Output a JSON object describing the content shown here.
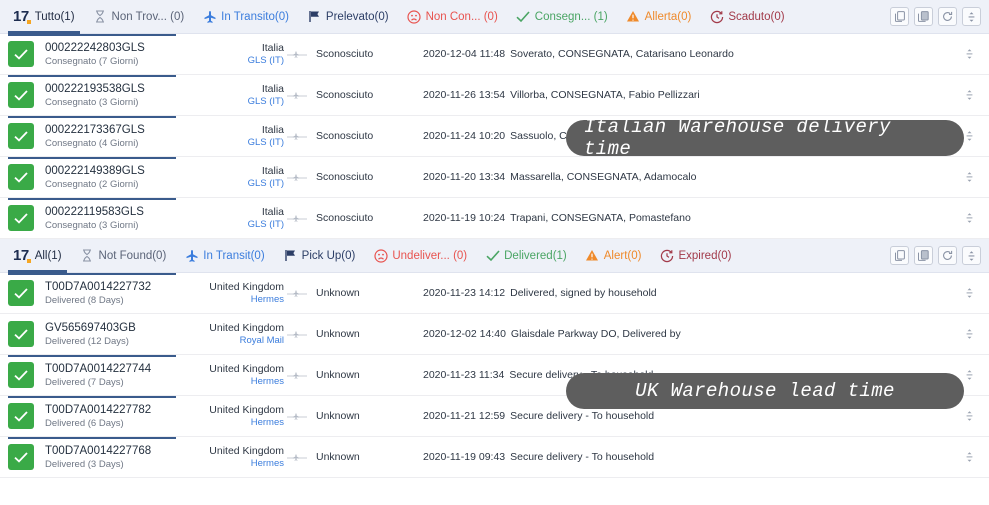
{
  "brand": {
    "logo_text": "17"
  },
  "panels": [
    {
      "id": "italian",
      "tabs": [
        {
          "label": "Tutto(1)",
          "icon": "logo-17-icon",
          "tone": "active"
        },
        {
          "label": "Non Trov... (0)",
          "icon": "hourglass-icon",
          "tone": "grey"
        },
        {
          "label": "In Transito(0)",
          "icon": "airplane-icon",
          "tone": "blue"
        },
        {
          "label": "Prelevato(0)",
          "icon": "flag-icon",
          "tone": "navy"
        },
        {
          "label": "Non Con... (0)",
          "icon": "sad-face-icon",
          "tone": "red"
        },
        {
          "label": "Consegn... (1)",
          "icon": "check-icon",
          "tone": "green"
        },
        {
          "label": "Allerta(0)",
          "icon": "warning-icon",
          "tone": "orange"
        },
        {
          "label": "Scaduto(0)",
          "icon": "clock-expired-icon",
          "tone": "maroon"
        }
      ],
      "toolbar": [
        {
          "name": "copy-button",
          "icon": "copy-icon"
        },
        {
          "name": "copy-all-button",
          "icon": "copy-multiple-icon"
        },
        {
          "name": "refresh-button",
          "icon": "refresh-icon"
        },
        {
          "name": "more-options-button",
          "icon": "more-vertical-icon"
        }
      ],
      "rows": [
        {
          "status": "delivered",
          "number": "000222242803GLS",
          "sub": "Consegnato (7 Giorni)",
          "country": "Italia",
          "carrier": "GLS (IT)",
          "destination": "Sconosciuto",
          "event_time": "2020-12-04 11:48",
          "event_text": "Soverato, CONSEGNATA, Catarisano Leonardo"
        },
        {
          "status": "delivered",
          "number": "000222193538GLS",
          "sub": "Consegnato (3 Giorni)",
          "country": "Italia",
          "carrier": "GLS (IT)",
          "destination": "Sconosciuto",
          "event_time": "2020-11-26 13:54",
          "event_text": "Villorba, CONSEGNATA, Fabio Pellizzari"
        },
        {
          "status": "delivered",
          "number": "000222173367GLS",
          "sub": "Consegnato (4 Giorni)",
          "country": "Italia",
          "carrier": "GLS (IT)",
          "destination": "Sconosciuto",
          "event_time": "2020-11-24 10:20",
          "event_text": "Sassuolo, CONSEGNATA, Cinzia Pieroni"
        },
        {
          "status": "delivered",
          "number": "000222149389GLS",
          "sub": "Consegnato (2 Giorni)",
          "country": "Italia",
          "carrier": "GLS (IT)",
          "destination": "Sconosciuto",
          "event_time": "2020-11-20 13:34",
          "event_text": "Massarella, CONSEGNATA, Adamocalo"
        },
        {
          "status": "delivered",
          "number": "000222119583GLS",
          "sub": "Consegnato (3 Giorni)",
          "country": "Italia",
          "carrier": "GLS (IT)",
          "destination": "Sconosciuto",
          "event_time": "2020-11-19 10:24",
          "event_text": "Trapani, CONSEGNATA, Pomastefano"
        }
      ],
      "annotation": "Italian Warehouse delivery time"
    },
    {
      "id": "uk",
      "tabs": [
        {
          "label": "All(1)",
          "icon": "logo-17-icon",
          "tone": "active"
        },
        {
          "label": "Not Found(0)",
          "icon": "hourglass-icon",
          "tone": "grey"
        },
        {
          "label": "In Transit(0)",
          "icon": "airplane-icon",
          "tone": "blue"
        },
        {
          "label": "Pick Up(0)",
          "icon": "flag-icon",
          "tone": "navy"
        },
        {
          "label": "Undeliver... (0)",
          "icon": "sad-face-icon",
          "tone": "red"
        },
        {
          "label": "Delivered(1)",
          "icon": "check-icon",
          "tone": "green"
        },
        {
          "label": "Alert(0)",
          "icon": "warning-icon",
          "tone": "orange"
        },
        {
          "label": "Expired(0)",
          "icon": "clock-expired-icon",
          "tone": "maroon"
        }
      ],
      "toolbar": [
        {
          "name": "copy-button",
          "icon": "copy-icon"
        },
        {
          "name": "copy-all-button",
          "icon": "copy-multiple-icon"
        },
        {
          "name": "refresh-button",
          "icon": "refresh-icon"
        },
        {
          "name": "more-options-button",
          "icon": "more-vertical-icon"
        }
      ],
      "rows": [
        {
          "status": "delivered",
          "number": "T00D7A0014227732",
          "sub": "Delivered (8 Days)",
          "country": "United Kingdom",
          "carrier": "Hermes",
          "destination": "Unknown",
          "event_time": "2020-11-23 14:12",
          "event_text": "Delivered, signed by household"
        },
        {
          "status": "delivered",
          "number": "GV565697403GB",
          "sub": "Delivered (12 Days)",
          "country": "United Kingdom",
          "carrier": "Royal Mail",
          "destination": "Unknown",
          "event_time": "2020-12-02 14:40",
          "event_text": "Glaisdale Parkway DO, Delivered by"
        },
        {
          "status": "delivered",
          "number": "T00D7A0014227744",
          "sub": "Delivered (7 Days)",
          "country": "United Kingdom",
          "carrier": "Hermes",
          "destination": "Unknown",
          "event_time": "2020-11-23 11:34",
          "event_text": "Secure delivery - To household"
        },
        {
          "status": "delivered",
          "number": "T00D7A0014227782",
          "sub": "Delivered (6 Days)",
          "country": "United Kingdom",
          "carrier": "Hermes",
          "destination": "Unknown",
          "event_time": "2020-11-21 12:59",
          "event_text": "Secure delivery - To household"
        },
        {
          "status": "delivered",
          "number": "T00D7A0014227768",
          "sub": "Delivered (3 Days)",
          "country": "United Kingdom",
          "carrier": "Hermes",
          "destination": "Unknown",
          "event_time": "2020-11-19 09:43",
          "event_text": "Secure delivery - To household"
        }
      ],
      "annotation": "UK Warehouse lead time"
    }
  ],
  "colors": {
    "tabbar_bg": "#eef1f8",
    "active_underline": "#3a5b8c",
    "delivered_green": "#3aaa47",
    "link_blue": "#3b7ddd",
    "annotation_bg": "#5e5e5e"
  }
}
